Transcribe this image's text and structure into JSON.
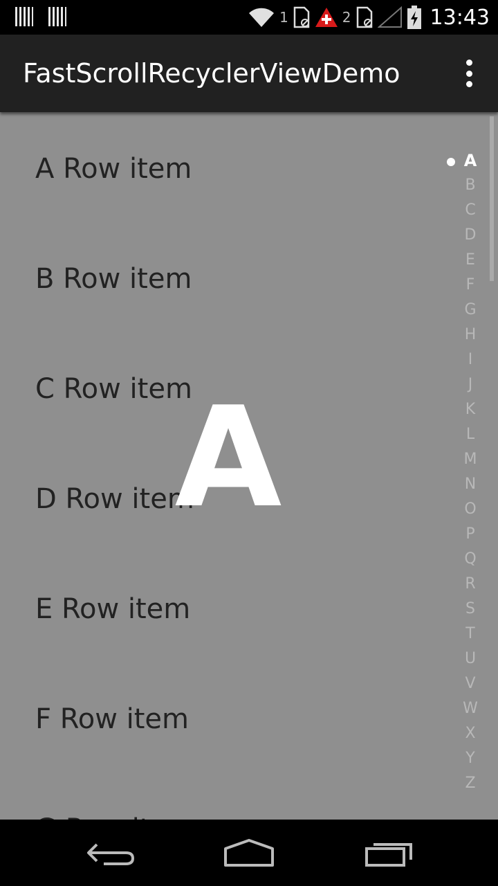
{
  "status_bar": {
    "sim1_label": "1",
    "sim2_label": "2",
    "time": "13:43",
    "icons": [
      "barcode-icon",
      "barcode-icon",
      "wifi-icon",
      "sim-card-icon",
      "warning-icon",
      "sim-card-icon",
      "signal-icon",
      "battery-charging-icon"
    ]
  },
  "app_bar": {
    "title": "FastScrollRecyclerViewDemo",
    "menu_icon": "overflow-menu-icon"
  },
  "list": {
    "rows": [
      "A Row item",
      "B Row item",
      "C Row item",
      "D Row item",
      "E Row item",
      "F Row item",
      "G Row item"
    ]
  },
  "index_bar": {
    "letters": [
      "A",
      "B",
      "C",
      "D",
      "E",
      "F",
      "G",
      "H",
      "I",
      "J",
      "K",
      "L",
      "M",
      "N",
      "O",
      "P",
      "Q",
      "R",
      "S",
      "T",
      "U",
      "V",
      "W",
      "X",
      "Y",
      "Z"
    ],
    "active": "A"
  },
  "section_preview": "A",
  "nav_bar": {
    "icons": [
      "back-icon",
      "home-icon",
      "recent-apps-icon"
    ]
  },
  "colors": {
    "list_background": "#8f8f8f",
    "app_bar": "#212121",
    "row_text": "#222222",
    "index_inactive": "#b8b8b8",
    "index_active": "#ffffff"
  }
}
